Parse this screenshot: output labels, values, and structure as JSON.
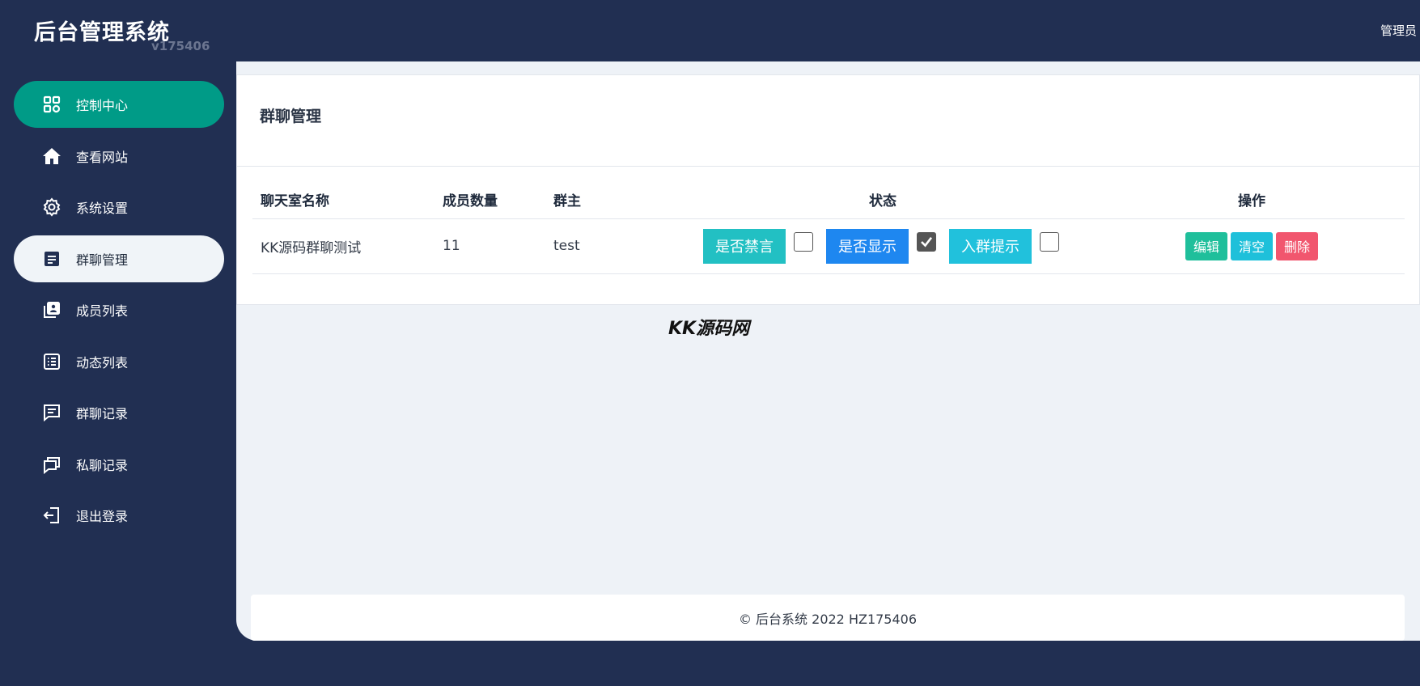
{
  "brand": {
    "title": "后台管理系统",
    "version": "v175406"
  },
  "header": {
    "user": "管理员"
  },
  "sidebar": {
    "items": [
      {
        "label": "控制中心",
        "icon": "grid-icon"
      },
      {
        "label": "查看网站",
        "icon": "home-icon"
      },
      {
        "label": "系统设置",
        "icon": "gear-icon"
      },
      {
        "label": "群聊管理",
        "icon": "list-card-icon"
      },
      {
        "label": "成员列表",
        "icon": "contacts-icon"
      },
      {
        "label": "动态列表",
        "icon": "list-icon"
      },
      {
        "label": "群聊记录",
        "icon": "message-icon"
      },
      {
        "label": "私聊记录",
        "icon": "chat-icon"
      },
      {
        "label": "退出登录",
        "icon": "logout-icon"
      }
    ]
  },
  "page": {
    "title": "群聊管理"
  },
  "table": {
    "headers": {
      "name": "聊天室名称",
      "members": "成员数量",
      "owner": "群主",
      "status": "状态",
      "actions": "操作"
    },
    "rows": [
      {
        "name": "KK源码群聊测试",
        "members": "11",
        "owner": "test",
        "status": {
          "mute_label": "是否禁言",
          "mute_checked": false,
          "show_label": "是否显示",
          "show_checked": true,
          "join_label": "入群提示",
          "join_checked": false
        },
        "actions": {
          "edit": "编辑",
          "clear": "清空",
          "delete": "删除"
        }
      }
    ]
  },
  "watermark": "KK源码网",
  "footer": {
    "text": "© 后台系统 2022 HZ175406"
  },
  "colors": {
    "sidebar_bg": "#212f52",
    "active": "#009b87",
    "main_bg": "#eef2f7",
    "delete": "#f1566e"
  }
}
